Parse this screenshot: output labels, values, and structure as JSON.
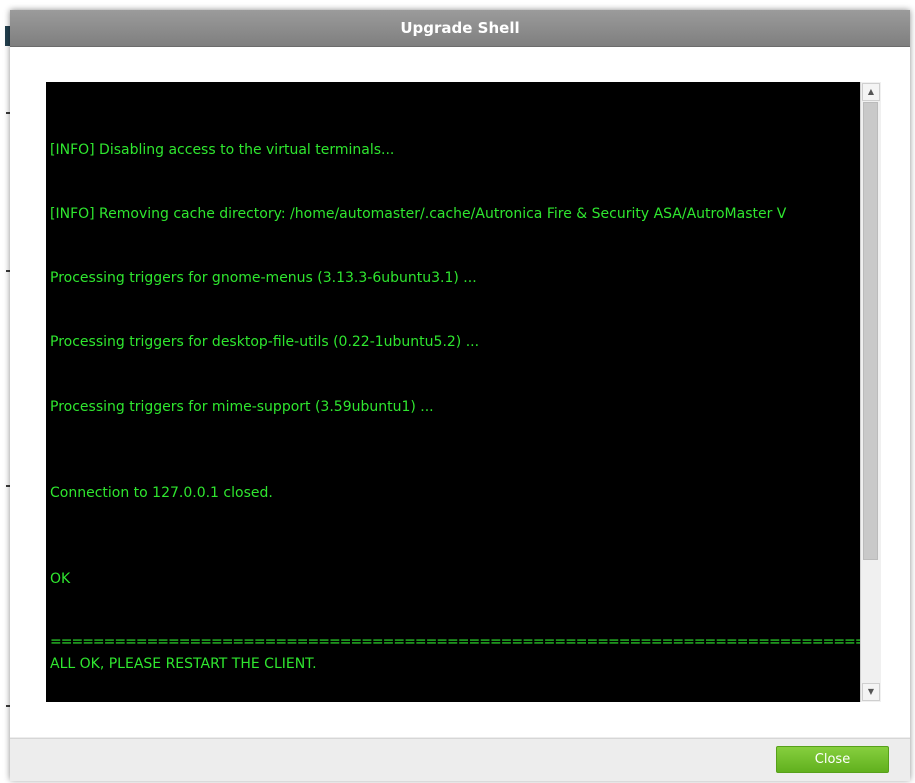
{
  "dialog": {
    "title": "Upgrade Shell",
    "close_label": "Close"
  },
  "terminal": {
    "text_color": "#2fe62f",
    "background": "#000000",
    "lines": [
      "[INFO] Disabling access to the virtual terminals...",
      "[INFO] Removing cache directory: /home/automaster/.cache/Autronica Fire & Security ASA/AutroMaster V",
      "Processing triggers for gnome-menus (3.13.3-6ubuntu3.1) ...",
      "Processing triggers for desktop-file-utils (0.22-1ubuntu5.2) ...",
      "Processing triggers for mime-support (3.59ubuntu1) ...",
      "Connection to 127.0.0.1 closed.",
      "OK",
      "=================================================================================================================",
      "ALL OK, PLEASE RESTART THE CLIENT."
    ]
  },
  "scrollbar": {
    "up_icon": "arrow-up-icon",
    "down_icon": "arrow-down-icon"
  },
  "colors": {
    "title_bar": "#8c8c8c",
    "close_button": "#6cbd2a"
  }
}
